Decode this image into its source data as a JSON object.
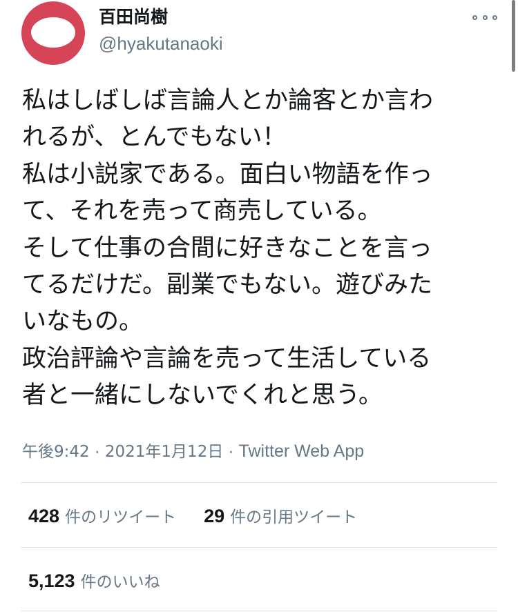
{
  "user": {
    "display_name": "百田尚樹",
    "handle": "@hyakutanaoki",
    "avatar_color": "#d64458"
  },
  "menu": {
    "icon": "more-horizontal-icon"
  },
  "tweet": {
    "lines": [
      "私はしばしば言論人とか論客とか言わ",
      "れるが、とんでもない！",
      "私は小説家である。面白い物語を作っ",
      "て、それを売って商売している。",
      "そして仕事の合間に好きなことを言っ",
      "てるだけだ。副業でもない。遊びみた",
      "いなもの。",
      "政治評論や言論を売って生活している",
      "者と一緒にしないでくれと思う。"
    ],
    "time": "午後9:42",
    "date": "2021年1月12日",
    "separator": "·",
    "source": "Twitter Web App"
  },
  "stats": {
    "retweets_count": "428",
    "retweets_label": "件のリツイート",
    "quotes_count": "29",
    "quotes_label": "件の引用ツイート",
    "likes_count": "5,123",
    "likes_label": "件のいいね"
  },
  "colors": {
    "text_primary": "#14171a",
    "text_secondary": "#657786",
    "divider": "#e1e8ed"
  }
}
